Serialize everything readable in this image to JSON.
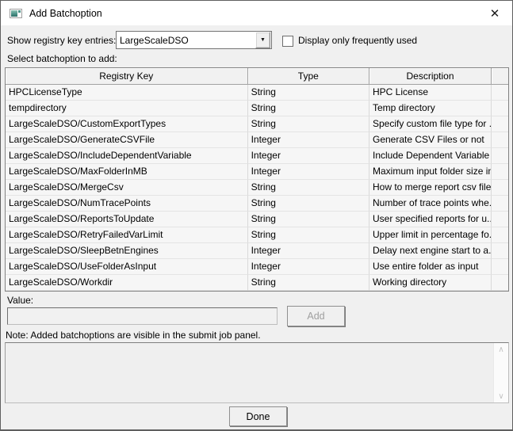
{
  "window": {
    "title": "Add Batchoption"
  },
  "icons": {
    "close": "✕",
    "dropdown_arrow": "▼",
    "scroll_up": "∧",
    "scroll_down": "∨"
  },
  "toolbar": {
    "registry_label": "Show registry key entries:",
    "registry_selected": "LargeScaleDSO",
    "frequent_label": "Display only frequently used",
    "frequent_checked": false,
    "select_label": "Select batchoption to add:"
  },
  "table": {
    "headers": [
      "Registry Key",
      "Type",
      "Description",
      ""
    ],
    "rows": [
      [
        "HPCLicenseType",
        "String",
        "HPC License"
      ],
      [
        "tempdirectory",
        "String",
        "Temp directory"
      ],
      [
        "LargeScaleDSO/CustomExportTypes",
        "String",
        "Specify custom file type for ..."
      ],
      [
        "LargeScaleDSO/GenerateCSVFile",
        "Integer",
        "Generate CSV Files or not"
      ],
      [
        "LargeScaleDSO/IncludeDependentVariable",
        "Integer",
        "Include Dependent Variable ..."
      ],
      [
        "LargeScaleDSO/MaxFolderInMB",
        "Integer",
        "Maximum input folder size in..."
      ],
      [
        "LargeScaleDSO/MergeCsv",
        "String",
        "How to merge report csv files"
      ],
      [
        "LargeScaleDSO/NumTracePoints",
        "String",
        "Number of trace points whe..."
      ],
      [
        "LargeScaleDSO/ReportsToUpdate",
        "String",
        "User specified reports for u..."
      ],
      [
        "LargeScaleDSO/RetryFailedVarLimit",
        "String",
        "Upper limit in percentage fo..."
      ],
      [
        "LargeScaleDSO/SleepBetnEngines",
        "Integer",
        "Delay next engine start to a..."
      ],
      [
        "LargeScaleDSO/UseFolderAsInput",
        "Integer",
        "Use entire folder as input"
      ],
      [
        "LargeScaleDSO/Workdir",
        "String",
        "Working directory"
      ]
    ]
  },
  "value_section": {
    "label": "Value:",
    "input_value": "",
    "add_button": "Add"
  },
  "note": {
    "text": "Note: Added batchoptions are visible in the submit job panel."
  },
  "footer": {
    "done_button": "Done"
  },
  "colors": {
    "titlebar_bg": "#ffffff",
    "dialog_bg": "#f0f0f0",
    "icon_teal": "#4e948a",
    "disabled_text": "#9f9f9f"
  }
}
